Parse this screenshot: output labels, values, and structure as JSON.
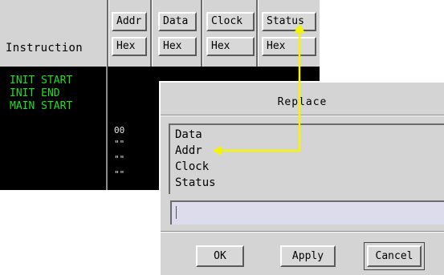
{
  "header": {
    "instruction_label": "Instruction",
    "columns": [
      {
        "name": "Addr",
        "format": "Hex"
      },
      {
        "name": "Data",
        "format": "Hex"
      },
      {
        "name": "Clock",
        "format": "Hex"
      },
      {
        "name": "Status",
        "format": "Hex"
      }
    ]
  },
  "listing": {
    "instructions": [
      "INIT START",
      "INIT END",
      "MAIN START"
    ],
    "values": [
      "00",
      "\"\"",
      "\"\"",
      "\"\""
    ]
  },
  "dialog": {
    "title": "Replace",
    "options": [
      "Data",
      "Addr",
      "Clock",
      "Status"
    ],
    "input_value": "",
    "buttons": {
      "ok": "OK",
      "apply": "Apply",
      "cancel": "Cancel"
    }
  },
  "colors": {
    "instruction_text": "#22dd22",
    "annotation_arrow": "#f5f500",
    "panel_bg": "#d4d4d4",
    "list_bg": "#000000"
  }
}
